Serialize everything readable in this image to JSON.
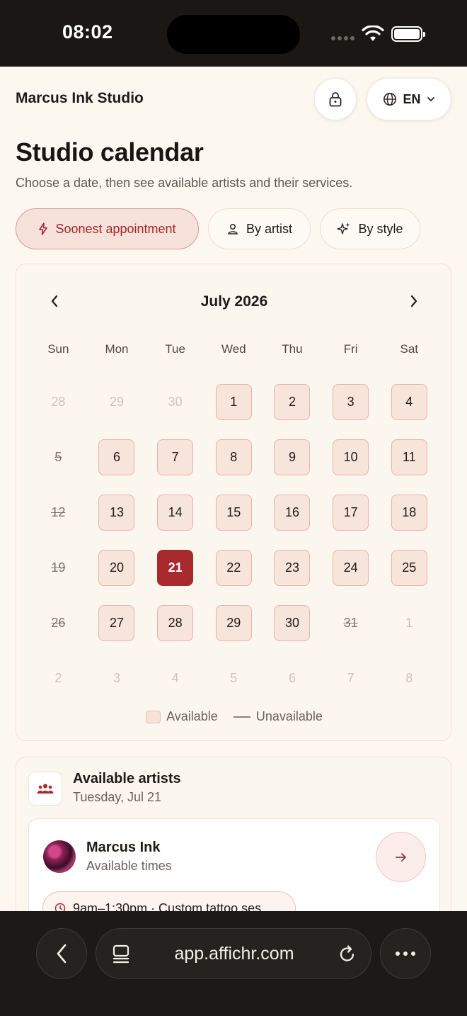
{
  "status_bar": {
    "time": "08:02"
  },
  "header": {
    "studio_name": "Marcus Ink Studio",
    "language": "EN"
  },
  "page": {
    "title": "Studio calendar",
    "subtitle": "Choose a date, then see available artists and their services."
  },
  "filters": [
    {
      "label": "Soonest appointment",
      "icon": "bolt-icon",
      "active": true
    },
    {
      "label": "By artist",
      "icon": "person-icon",
      "active": false
    },
    {
      "label": "By style",
      "icon": "sparkle-icon",
      "active": false
    }
  ],
  "calendar": {
    "month_label": "July 2026",
    "weekdays": [
      "Sun",
      "Mon",
      "Tue",
      "Wed",
      "Thu",
      "Fri",
      "Sat"
    ],
    "days": [
      {
        "label": "28",
        "state": "muted"
      },
      {
        "label": "29",
        "state": "muted"
      },
      {
        "label": "30",
        "state": "muted"
      },
      {
        "label": "1",
        "state": "avail"
      },
      {
        "label": "2",
        "state": "avail"
      },
      {
        "label": "3",
        "state": "avail"
      },
      {
        "label": "4",
        "state": "avail"
      },
      {
        "label": "5",
        "state": "unavail"
      },
      {
        "label": "6",
        "state": "avail"
      },
      {
        "label": "7",
        "state": "avail"
      },
      {
        "label": "8",
        "state": "avail"
      },
      {
        "label": "9",
        "state": "avail"
      },
      {
        "label": "10",
        "state": "avail"
      },
      {
        "label": "11",
        "state": "avail"
      },
      {
        "label": "12",
        "state": "unavail"
      },
      {
        "label": "13",
        "state": "avail"
      },
      {
        "label": "14",
        "state": "avail"
      },
      {
        "label": "15",
        "state": "avail"
      },
      {
        "label": "16",
        "state": "avail"
      },
      {
        "label": "17",
        "state": "avail"
      },
      {
        "label": "18",
        "state": "avail"
      },
      {
        "label": "19",
        "state": "unavail"
      },
      {
        "label": "20",
        "state": "avail"
      },
      {
        "label": "21",
        "state": "selected"
      },
      {
        "label": "22",
        "state": "avail"
      },
      {
        "label": "23",
        "state": "avail"
      },
      {
        "label": "24",
        "state": "avail"
      },
      {
        "label": "25",
        "state": "avail"
      },
      {
        "label": "26",
        "state": "unavail"
      },
      {
        "label": "27",
        "state": "avail"
      },
      {
        "label": "28",
        "state": "avail"
      },
      {
        "label": "29",
        "state": "avail"
      },
      {
        "label": "30",
        "state": "avail"
      },
      {
        "label": "31",
        "state": "unavail"
      },
      {
        "label": "1",
        "state": "muted"
      },
      {
        "label": "2",
        "state": "muted"
      },
      {
        "label": "3",
        "state": "muted"
      },
      {
        "label": "4",
        "state": "muted"
      },
      {
        "label": "5",
        "state": "muted"
      },
      {
        "label": "6",
        "state": "muted"
      },
      {
        "label": "7",
        "state": "muted"
      },
      {
        "label": "8",
        "state": "muted"
      }
    ],
    "legend": {
      "available": "Available",
      "unavailable": "Unavailable"
    }
  },
  "artists": {
    "title": "Available artists",
    "date": "Tuesday, Jul 21",
    "items": [
      {
        "name": "Marcus Ink",
        "subtitle": "Available times",
        "slot": "9am–1:30pm · Custom tattoo ses"
      }
    ]
  },
  "browser": {
    "url": "app.affichr.com"
  },
  "colors": {
    "accent": "#a92a2d",
    "available_bg": "#f7e4da",
    "page_bg": "#fcf8f0"
  }
}
